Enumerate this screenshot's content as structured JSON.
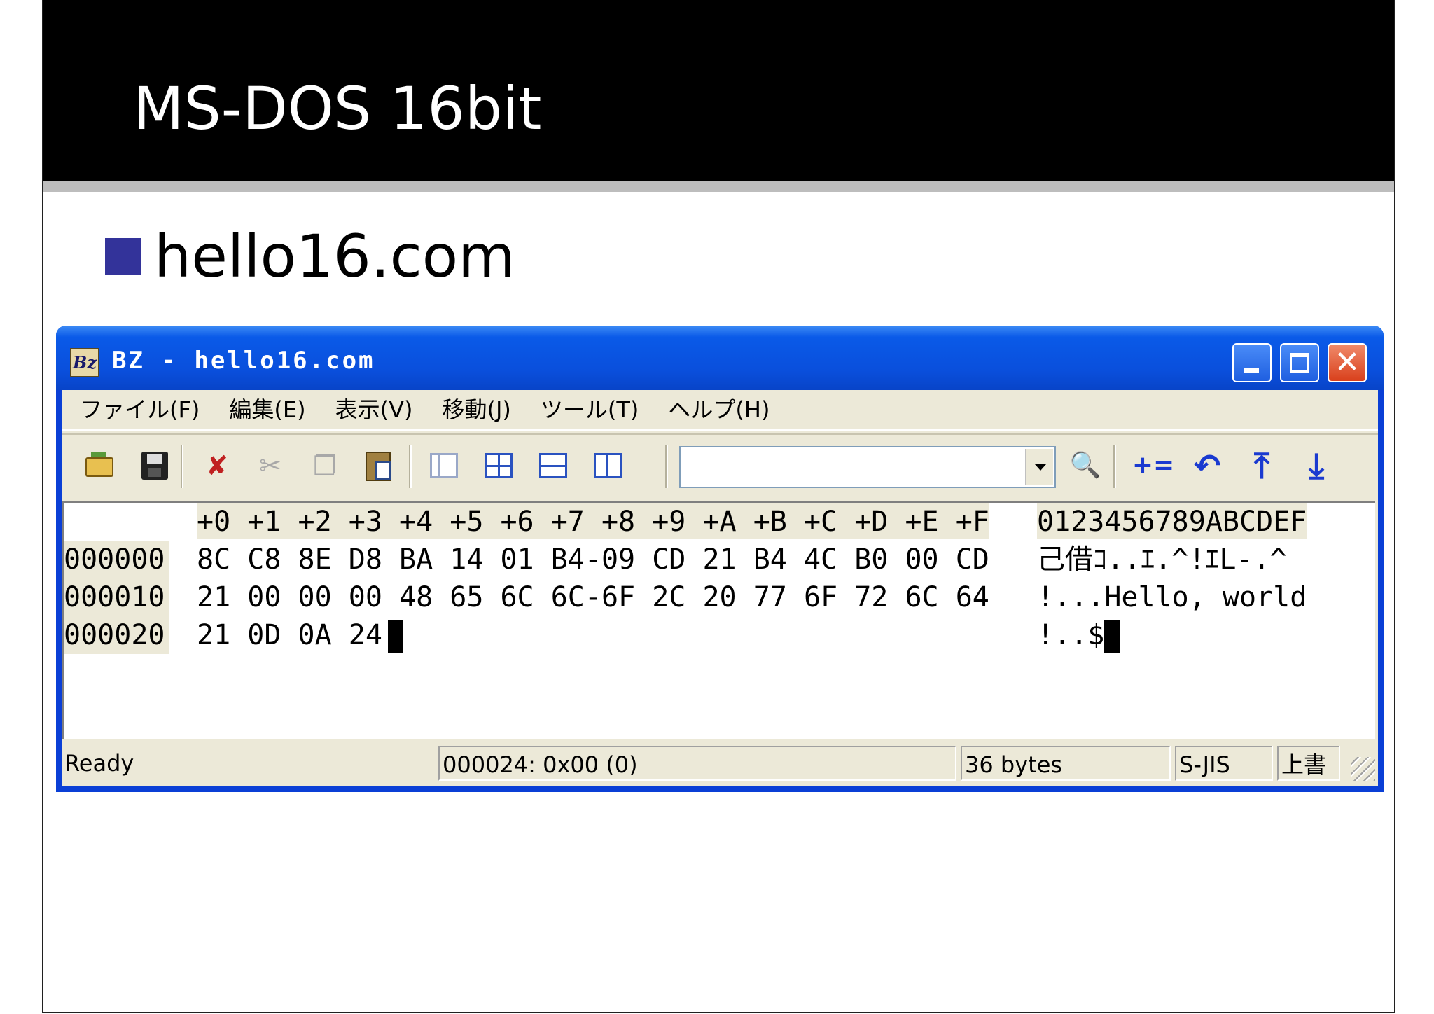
{
  "slide": {
    "title": "MS-DOS 16bit",
    "bullet": "hello16.com"
  },
  "window": {
    "title": "BZ - hello16.com",
    "icon_label": "Bz",
    "close_glyph": "✕"
  },
  "menu": {
    "items": [
      "ファイル(F)",
      "編集(E)",
      "表示(V)",
      "移動(J)",
      "ツール(T)",
      "ヘルプ(H)"
    ]
  },
  "toolbar": {
    "search_value": "",
    "icons": [
      "open-icon",
      "save-icon",
      "delete-icon",
      "cut-icon",
      "copy-icon",
      "paste-icon",
      "single-view-icon",
      "split-vertical-icon",
      "split-horizontal-icon",
      "compare-view-icon",
      "find-icon",
      "calculate-icon",
      "undo-icon",
      "jump-top-icon",
      "jump-bottom-icon"
    ],
    "calc_label": "+=",
    "undo_label": "↶",
    "top_label": "⤒",
    "bottom_label": "⤓",
    "find_label": "🔍"
  },
  "hex": {
    "column_header": "+0 +1 +2 +3 +4 +5 +6 +7 +8 +9 +A +B +C +D +E +F",
    "ascii_header": "0123456789ABCDEF",
    "rows": [
      {
        "address": "000000",
        "bytes": "8C C8 8E D8 BA 14 01 B4-09 CD 21 B4 4C B0 00 CD",
        "ascii": "己借ｺ..ｴ.^!ｴL-.^"
      },
      {
        "address": "000010",
        "bytes": "21 00 00 00 48 65 6C 6C-6F 2C 20 77 6F 72 6C 64",
        "ascii": "!...Hello, world"
      },
      {
        "address": "000020",
        "bytes": "21 0D 0A 24",
        "ascii": "!..$"
      }
    ]
  },
  "status": {
    "ready": "Ready",
    "position": "000024: 0x00 (0)",
    "size": "36 bytes",
    "encoding": "S-JIS",
    "mode": "上書"
  },
  "colors": {
    "titlebar": "#0a4fdc",
    "bullet": "#33339a",
    "window_face": "#ece9d8"
  }
}
